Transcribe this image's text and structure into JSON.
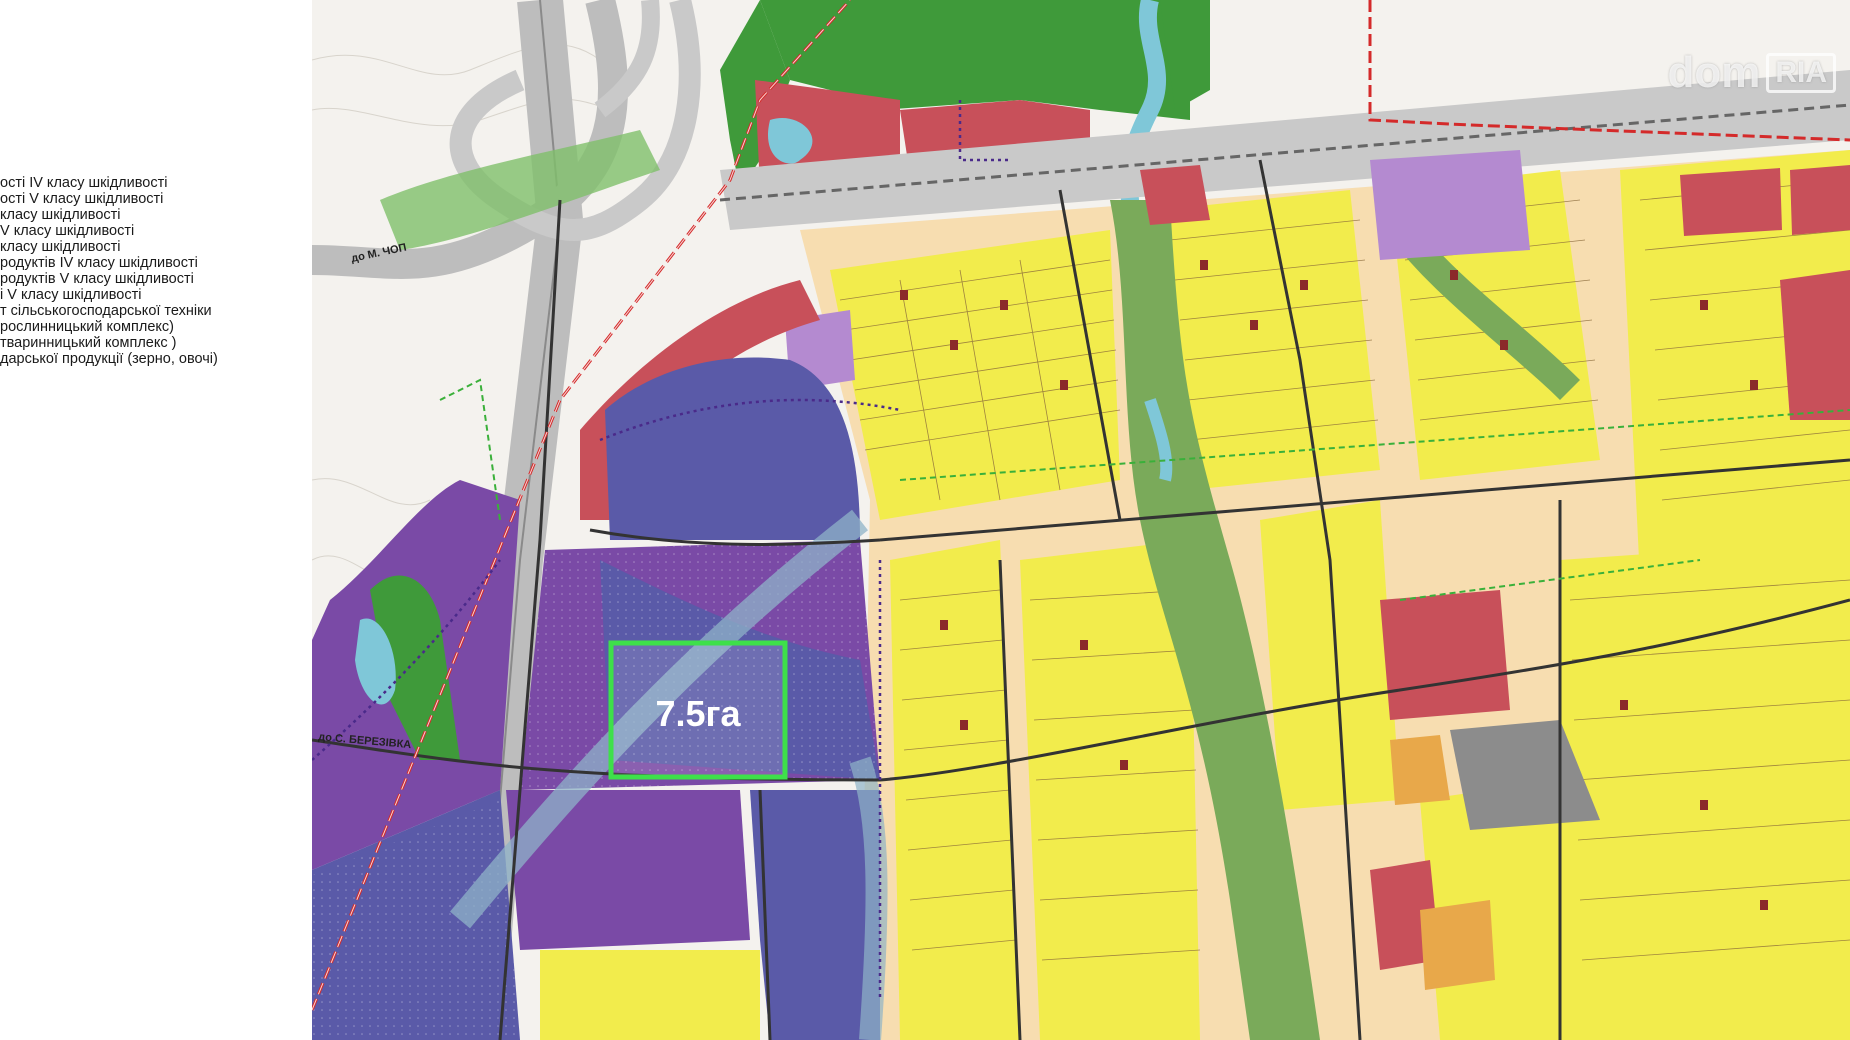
{
  "legend": {
    "items": [
      "ості IV класу шкідливості",
      "ості V класу шкідливості",
      "класу шкідливості",
      "V класу шкідливості",
      "класу шкідливості",
      "родуктів IV класу шкідливості",
      "родуктів V класу шкідливості",
      "і  V класу шкідливості",
      "т сільськогосподарської техніки",
      "рослинницький комплекс)",
      "тваринницький комплекс )",
      "дарської продукції (зерно, овочі)"
    ]
  },
  "map": {
    "road_labels": {
      "chop": "до М. ЧОП",
      "berezivka": "до С. БЕРЕЗІВКА"
    },
    "plot_label": "7.5га",
    "watermark": {
      "part1": "dom",
      "part2": "RIA"
    },
    "colors": {
      "industrial_purple": "#7a4aa6",
      "industrial_blue": "#5a5aa8",
      "residential_yellow": "#f2ec4c",
      "residential_cream": "#f7ddb0",
      "public_red": "#c8505a",
      "green_zone": "#3f9a3a",
      "greenway": "#7aaa5a",
      "highlight_green": "#3ee04a"
    }
  }
}
